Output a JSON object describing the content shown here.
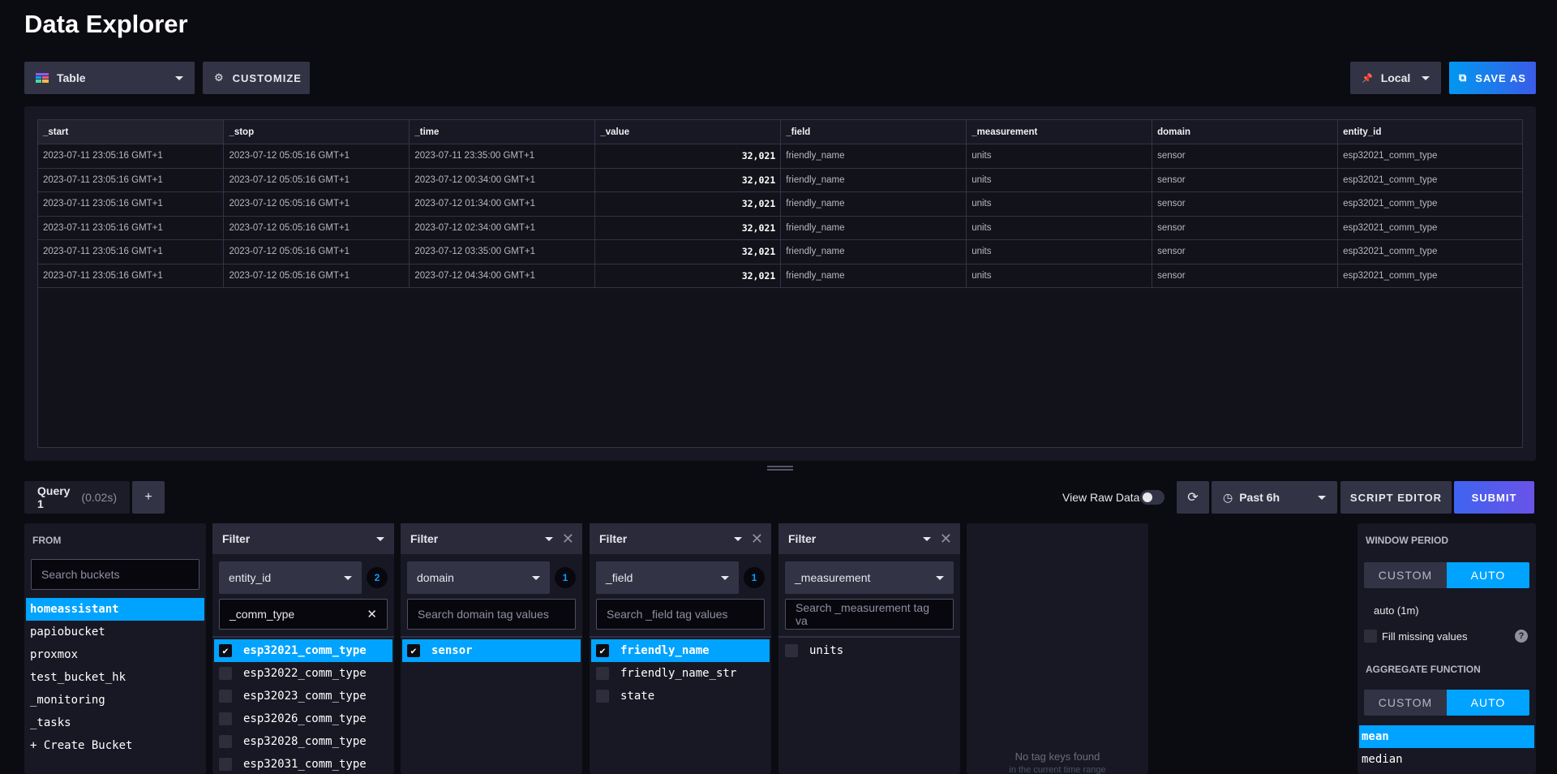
{
  "page": {
    "title": "Data Explorer"
  },
  "toolbar": {
    "viz_type": "Table",
    "customize": "CUSTOMIZE",
    "timezone": "Local",
    "save_as": "SAVE AS"
  },
  "table": {
    "columns": [
      "_start",
      "_stop",
      "_time",
      "_value",
      "_field",
      "_measurement",
      "domain",
      "entity_id"
    ],
    "rows": [
      [
        "2023-07-11 23:05:16 GMT+1",
        "2023-07-12 05:05:16 GMT+1",
        "2023-07-11 23:35:00 GMT+1",
        "32,021",
        "friendly_name",
        "units",
        "sensor",
        "esp32021_comm_type"
      ],
      [
        "2023-07-11 23:05:16 GMT+1",
        "2023-07-12 05:05:16 GMT+1",
        "2023-07-12 00:34:00 GMT+1",
        "32,021",
        "friendly_name",
        "units",
        "sensor",
        "esp32021_comm_type"
      ],
      [
        "2023-07-11 23:05:16 GMT+1",
        "2023-07-12 05:05:16 GMT+1",
        "2023-07-12 01:34:00 GMT+1",
        "32,021",
        "friendly_name",
        "units",
        "sensor",
        "esp32021_comm_type"
      ],
      [
        "2023-07-11 23:05:16 GMT+1",
        "2023-07-12 05:05:16 GMT+1",
        "2023-07-12 02:34:00 GMT+1",
        "32,021",
        "friendly_name",
        "units",
        "sensor",
        "esp32021_comm_type"
      ],
      [
        "2023-07-11 23:05:16 GMT+1",
        "2023-07-12 05:05:16 GMT+1",
        "2023-07-12 03:35:00 GMT+1",
        "32,021",
        "friendly_name",
        "units",
        "sensor",
        "esp32021_comm_type"
      ],
      [
        "2023-07-11 23:05:16 GMT+1",
        "2023-07-12 05:05:16 GMT+1",
        "2023-07-12 04:34:00 GMT+1",
        "32,021",
        "friendly_name",
        "units",
        "sensor",
        "esp32021_comm_type"
      ]
    ]
  },
  "query_bar": {
    "tab_label": "Query 1",
    "tab_time": "(0.02s)",
    "add": "+",
    "view_raw": "View Raw Data",
    "time_range": "Past 6h",
    "script_editor": "SCRIPT EDITOR",
    "submit": "SUBMIT"
  },
  "from": {
    "title": "FROM",
    "search_placeholder": "Search buckets",
    "buckets": [
      "homeassistant",
      "papiobucket",
      "proxmox",
      "test_bucket_hk",
      "_monitoring",
      "_tasks"
    ],
    "selected_index": 0,
    "create": "+ Create Bucket"
  },
  "filters": [
    {
      "header": "Filter",
      "key": "entity_id",
      "badge": "2",
      "search_value": "_comm_type",
      "search_placeholder": "",
      "items": [
        "esp32021_comm_type",
        "esp32022_comm_type",
        "esp32023_comm_type",
        "esp32026_comm_type",
        "esp32028_comm_type",
        "esp32031_comm_type"
      ],
      "selected": [
        0
      ]
    },
    {
      "header": "Filter",
      "key": "domain",
      "badge": "1",
      "search_value": "",
      "search_placeholder": "Search domain tag values",
      "items": [
        "sensor"
      ],
      "selected": [
        0
      ]
    },
    {
      "header": "Filter",
      "key": "_field",
      "badge": "1",
      "search_value": "",
      "search_placeholder": "Search _field tag values",
      "items": [
        "friendly_name",
        "friendly_name_str",
        "state"
      ],
      "selected": [
        0
      ]
    },
    {
      "header": "Filter",
      "key": "_measurement",
      "badge": "",
      "search_value": "",
      "search_placeholder": "Search _measurement tag va",
      "items": [
        "units"
      ],
      "selected": []
    }
  ],
  "empty_card": {
    "line1": "No tag keys found",
    "line2": "in the current time range"
  },
  "aggregate": {
    "window_title": "WINDOW PERIOD",
    "custom": "CUSTOM",
    "auto": "AUTO",
    "auto_value": "auto (1m)",
    "fill_missing": "Fill missing values",
    "help": "?",
    "function_title": "AGGREGATE FUNCTION",
    "functions": [
      "mean",
      "median"
    ],
    "selected_function": 0
  },
  "colors": {
    "accent": "#00a3ff",
    "submit": "#5b5ae8",
    "panel": "#181824",
    "background": "#0b0b12"
  }
}
